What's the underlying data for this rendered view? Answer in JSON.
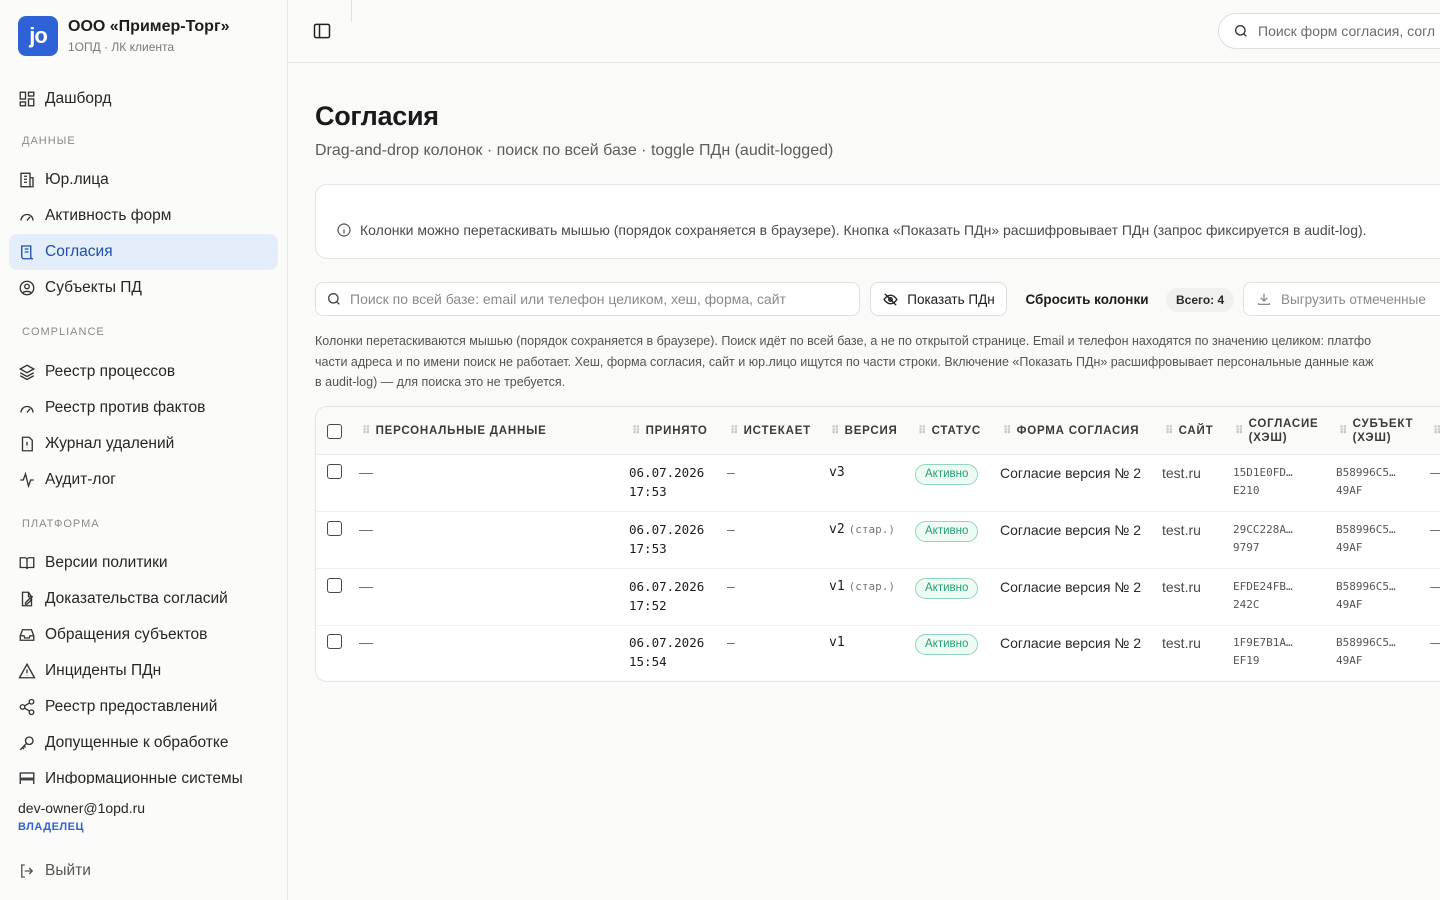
{
  "brand": {
    "logo": "jo",
    "name": "ООО «Пример-Торг»",
    "subtitle": "1ОПД · ЛК клиента"
  },
  "sidebar": {
    "dashboard": {
      "label": "Дашборд",
      "icon": "dashboard-icon"
    },
    "sections": [
      {
        "title": "ДАННЫЕ",
        "items": [
          {
            "label": "Юр.лица",
            "icon": "building-icon"
          },
          {
            "label": "Активность форм",
            "icon": "gauge-icon"
          },
          {
            "label": "Согласия",
            "icon": "scroll-icon",
            "active": true
          },
          {
            "label": "Субъекты ПД",
            "icon": "user-circle-icon"
          }
        ]
      },
      {
        "title": "COMPLIANCE",
        "items": [
          {
            "label": "Реестр процессов",
            "icon": "layers-icon"
          },
          {
            "label": "Реестр против фактов",
            "icon": "gauge-icon"
          },
          {
            "label": "Журнал удалений",
            "icon": "file-alert-icon"
          },
          {
            "label": "Аудит-лог",
            "icon": "activity-icon"
          }
        ]
      },
      {
        "title": "ПЛАТФОРМА",
        "items": [
          {
            "label": "Версии политики",
            "icon": "book-icon"
          },
          {
            "label": "Доказательства согласий",
            "icon": "file-edit-icon"
          },
          {
            "label": "Обращения субъектов",
            "icon": "inbox-icon"
          },
          {
            "label": "Инциденты ПДн",
            "icon": "alert-triangle-icon"
          },
          {
            "label": "Реестр предоставлений",
            "icon": "share-icon"
          },
          {
            "label": "Допущенные к обработке",
            "icon": "key-icon"
          },
          {
            "label": "Информационные системы",
            "icon": "server-icon"
          }
        ]
      }
    ],
    "user_email": "dev-owner@1opd.ru",
    "user_role": "ВЛАДЕЛЕЦ",
    "logout": "Выйти"
  },
  "topbar": {
    "search_placeholder": "Поиск форм согласия, согл"
  },
  "page": {
    "title": "Согласия",
    "subtitle": "Drag-and-drop колонок · поиск по всей базе · toggle ПДн (audit-logged)",
    "info": "Колонки можно перетаскивать мышью (порядок сохраняется в браузере). Кнопка «Показать ПДн» расшифровывает ПДн (запрос фиксируется в audit-log)."
  },
  "toolbar": {
    "search_placeholder": "Поиск по всей базе: email или телефон целиком, хеш, форма, сайт",
    "show_pd": "Показать ПДн",
    "reset_columns": "Сбросить колонки",
    "total": "Всего: 4",
    "export": "Выгрузить отмеченные"
  },
  "help": {
    "line1": "Колонки перетаскиваются мышью (порядок сохраняется в браузере). Поиск идёт по всей базе, а не по открытой странице. Email и телефон находятся по значению целиком: платфо",
    "line2": "части адреса и по имени поиск не работает. Хеш, форма согласия, сайт и юр.лицо ищутся по части строки. Включение «Показать ПДн» расшифровывает персональные данные каж",
    "line3": "в audit-log) — для поиска это не требуется."
  },
  "table": {
    "columns": {
      "pd": "ПЕРСОНАЛЬНЫЕ ДАННЫЕ",
      "accepted": "ПРИНЯТО",
      "expires": "ИСТЕКАЕТ",
      "version": "ВЕРСИЯ",
      "status": "СТАТУС",
      "form": "ФОРМА СОГЛАСИЯ",
      "site": "САЙТ",
      "consent_hash_1": "СОГЛАСИЕ",
      "consent_hash_2": "(ХЭШ)",
      "subject_hash_1": "СУБЪЕКТ",
      "subject_hash_2": "(ХЭШ)"
    },
    "rows": [
      {
        "pd": "—",
        "date": "06.07.2026",
        "time": "17:53",
        "expires": "–",
        "version": "v3",
        "version_note": "",
        "status": "Активно",
        "form": "Согласие версия № 2",
        "site": "test.ru",
        "consent_hash_1": "15D1E0FD…",
        "consent_hash_2": "E210",
        "subject_hash_1": "B58996C5…",
        "subject_hash_2": "49AF",
        "extra": "—"
      },
      {
        "pd": "—",
        "date": "06.07.2026",
        "time": "17:53",
        "expires": "–",
        "version": "v2",
        "version_note": "(стар.)",
        "status": "Активно",
        "form": "Согласие версия № 2",
        "site": "test.ru",
        "consent_hash_1": "29CC228A…",
        "consent_hash_2": "9797",
        "subject_hash_1": "B58996C5…",
        "subject_hash_2": "49AF",
        "extra": "—"
      },
      {
        "pd": "—",
        "date": "06.07.2026",
        "time": "17:52",
        "expires": "–",
        "version": "v1",
        "version_note": "(стар.)",
        "status": "Активно",
        "form": "Согласие версия № 2",
        "site": "test.ru",
        "consent_hash_1": "EFDE24FB…",
        "consent_hash_2": "242C",
        "subject_hash_1": "B58996C5…",
        "subject_hash_2": "49AF",
        "extra": "—"
      },
      {
        "pd": "—",
        "date": "06.07.2026",
        "time": "15:54",
        "expires": "–",
        "version": "v1",
        "version_note": "",
        "status": "Активно",
        "form": "Согласие версия № 2",
        "site": "test.ru",
        "consent_hash_1": "1F9E7B1A…",
        "consent_hash_2": "EF19",
        "subject_hash_1": "B58996C5…",
        "subject_hash_2": "49AF",
        "extra": "—"
      }
    ]
  },
  "colors": {
    "accent": "#2f62d6",
    "active_bg": "#e4eefb",
    "status_green": "#26a072"
  }
}
